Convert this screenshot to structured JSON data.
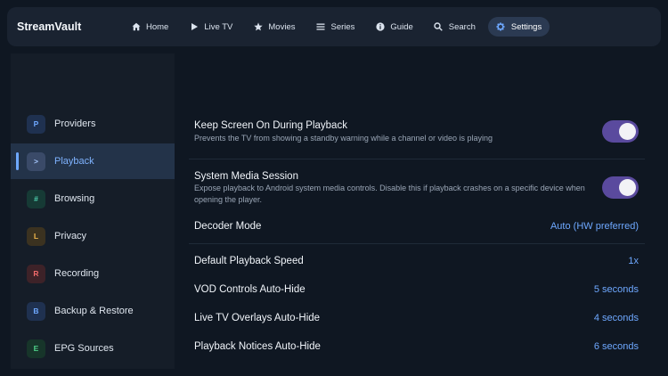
{
  "app": {
    "title": "StreamVault"
  },
  "nav": {
    "items": [
      {
        "label": "Home",
        "icon": "home-icon"
      },
      {
        "label": "Live TV",
        "icon": "play-icon"
      },
      {
        "label": "Movies",
        "icon": "star-icon"
      },
      {
        "label": "Series",
        "icon": "list-icon"
      },
      {
        "label": "Guide",
        "icon": "info-icon"
      },
      {
        "label": "Search",
        "icon": "search-icon"
      },
      {
        "label": "Settings",
        "icon": "gear-icon",
        "active": true
      }
    ]
  },
  "sidebar": {
    "items": [
      {
        "label": "Providers",
        "badge": "P",
        "badge_color": "#6ea8ff",
        "badge_bg": "#1f3150"
      },
      {
        "label": "Playback",
        "badge": ">",
        "badge_color": "#a8c8ff",
        "badge_bg": "#3a4a68",
        "active": true
      },
      {
        "label": "Browsing",
        "badge": "#",
        "badge_color": "#4fd1b0",
        "badge_bg": "#163a35"
      },
      {
        "label": "Privacy",
        "badge": "L",
        "badge_color": "#f0b64a",
        "badge_bg": "#3b3220"
      },
      {
        "label": "Recording",
        "badge": "R",
        "badge_color": "#f06a6a",
        "badge_bg": "#3d2228"
      },
      {
        "label": "Backup & Restore",
        "badge": "B",
        "badge_color": "#6ea8ff",
        "badge_bg": "#1f3150"
      },
      {
        "label": "EPG Sources",
        "badge": "E",
        "badge_color": "#4fd18a",
        "badge_bg": "#17352a"
      }
    ]
  },
  "settings": {
    "keep_screen": {
      "title": "Keep Screen On During Playback",
      "description": "Prevents the TV from showing a standby warning while a channel or video is playing",
      "enabled": true
    },
    "media_session": {
      "title": "System Media Session",
      "description": "Expose playback to Android system media controls. Disable this if playback crashes on a specific device when opening the player.",
      "enabled": true
    },
    "decoder_mode": {
      "title": "Decoder Mode",
      "value": "Auto (HW preferred)"
    },
    "playback_speed": {
      "title": "Default Playback Speed",
      "value": "1x"
    },
    "vod_autohide": {
      "title": "VOD Controls Auto-Hide",
      "value": "5 seconds"
    },
    "live_autohide": {
      "title": "Live TV Overlays Auto-Hide",
      "value": "4 seconds"
    },
    "notices_autohide": {
      "title": "Playback Notices Auto-Hide",
      "value": "6 seconds"
    }
  },
  "colors": {
    "accent": "#6ea8ff",
    "toggle_on": "#5a4a9e"
  }
}
